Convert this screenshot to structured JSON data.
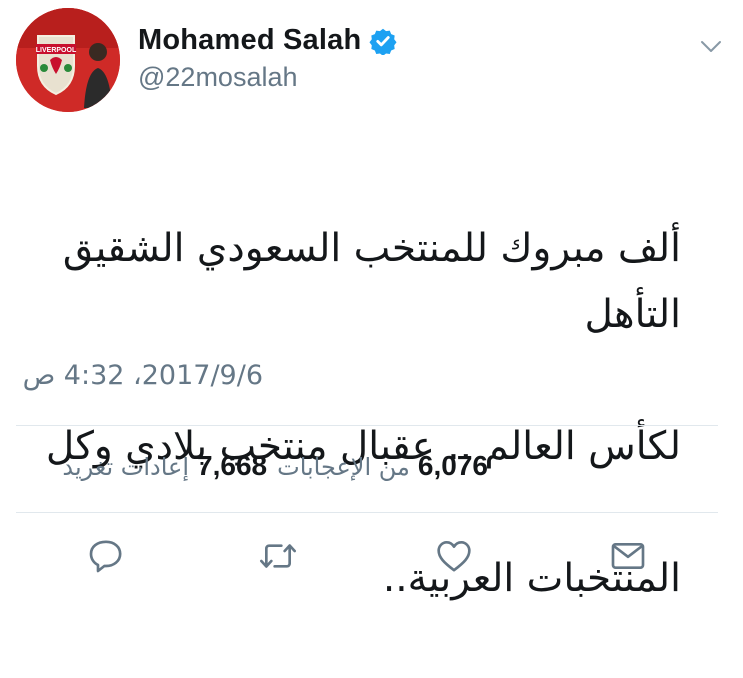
{
  "user": {
    "display_name": "Mohamed Salah",
    "handle": "@22mosalah",
    "avatar_badge_text": "LIVERPOOL"
  },
  "tweet": {
    "lines": [
      "ألف مبروك للمنتخب السعودي الشقيق التأهل",
      "لكأس العالم .. عقبال منتخب بلادي وكل",
      "المنتخبات العربية.."
    ],
    "timestamp": "2017/9/6، 4:32 ص"
  },
  "stats": {
    "retweets_count": "7,668",
    "retweets_label": "إعادات تغريد",
    "likes_count": "6,076",
    "likes_label": "من الإعجابات"
  },
  "icons": {
    "verified": "verified-badge-icon",
    "more": "chevron-down-icon",
    "reply": "reply-icon",
    "retweet": "retweet-icon",
    "like": "heart-icon",
    "message": "envelope-icon"
  },
  "colors": {
    "verified_blue": "#1da1f2",
    "secondary_text": "#657786",
    "icon_gray": "#657786",
    "divider": "#e1e8ed",
    "avatar_red": "#d9302a"
  }
}
